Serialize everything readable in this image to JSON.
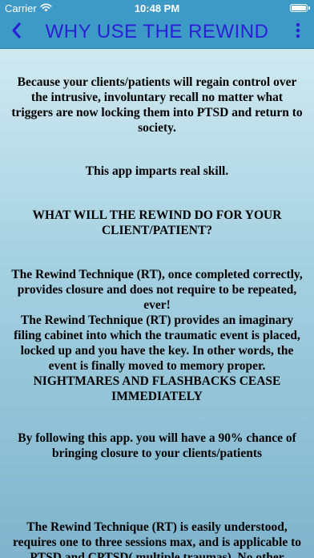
{
  "status_bar": {
    "carrier": "Carrier",
    "time": "10:48 PM"
  },
  "nav": {
    "title": "WHY USE THE REWIND",
    "back_icon": "chevron-left-icon",
    "more_icon": "vertical-ellipsis-icon",
    "title_color": "#2a1fd6",
    "bar_color": "#3d99c6"
  },
  "content": {
    "intro": "Because your clients/patients will regain control over the intrusive, involuntary recall no matter what triggers are now locking them into PTSD and return to society.",
    "skill": "This app imparts real skill.",
    "question": "WHAT WILL THE REWIND DO FOR YOUR CLIENT/PATIENT?",
    "rt_block": "The Rewind Technique (RT), once completed correctly, provides closure and does not require to be repeated, ever!\nThe Rewind Technique (RT) provides an imaginary filing cabinet into which the traumatic event is placed, locked up and you have the key. In other words, the event is finally moved to memory proper.\nNIGHTMARES AND FLASHBACKS CEASE IMMEDIATELY",
    "chance": "By following this app. you will have a 90% chance of bringing closure to your clients/patients",
    "understood": "The Rewind Technique (RT) is easily understood, requires one to three sessions max, and is applicable to PTSD and CPTSD( multiple traumas). No other"
  }
}
